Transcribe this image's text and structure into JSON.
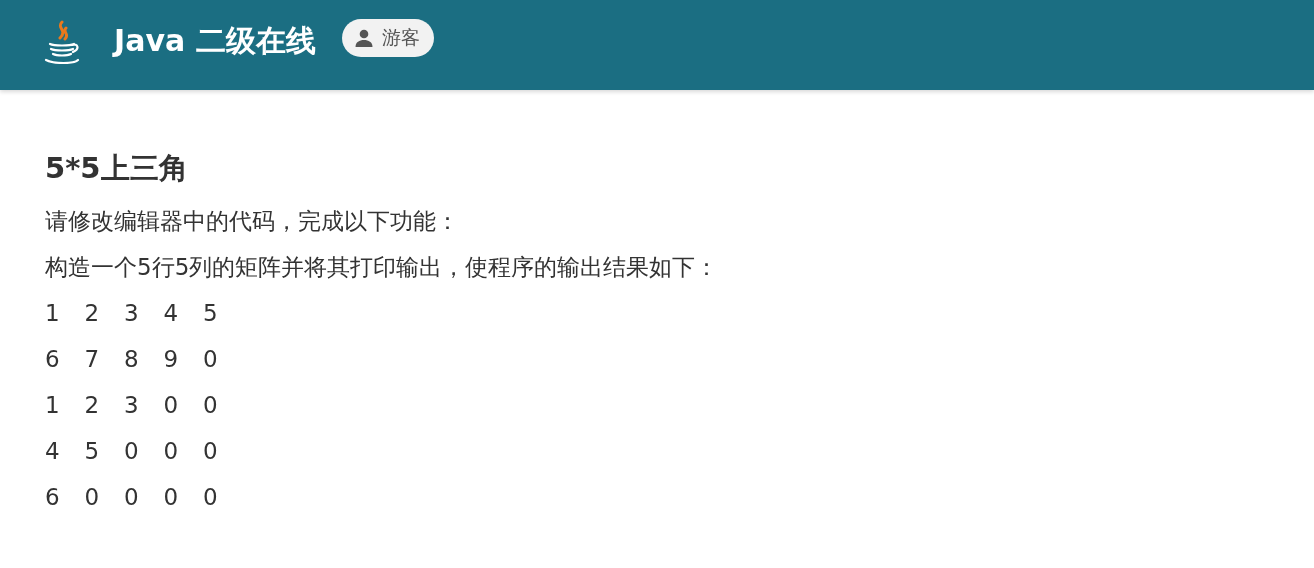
{
  "header": {
    "title": "Java 二级在线",
    "user_badge": "游客"
  },
  "problem": {
    "title": "5*5上三角",
    "lines": [
      "请修改编辑器中的代码，完成以下功能：",
      "构造一个5行5列的矩阵并将其打印输出，使程序的输出结果如下："
    ],
    "matrix": [
      [
        "1",
        "2",
        "3",
        "4",
        "5"
      ],
      [
        "6",
        "7",
        "8",
        "9",
        "0"
      ],
      [
        "1",
        "2",
        "3",
        "0",
        "0"
      ],
      [
        "4",
        "5",
        "0",
        "0",
        "0"
      ],
      [
        "6",
        "0",
        "0",
        "0",
        "0"
      ]
    ]
  }
}
